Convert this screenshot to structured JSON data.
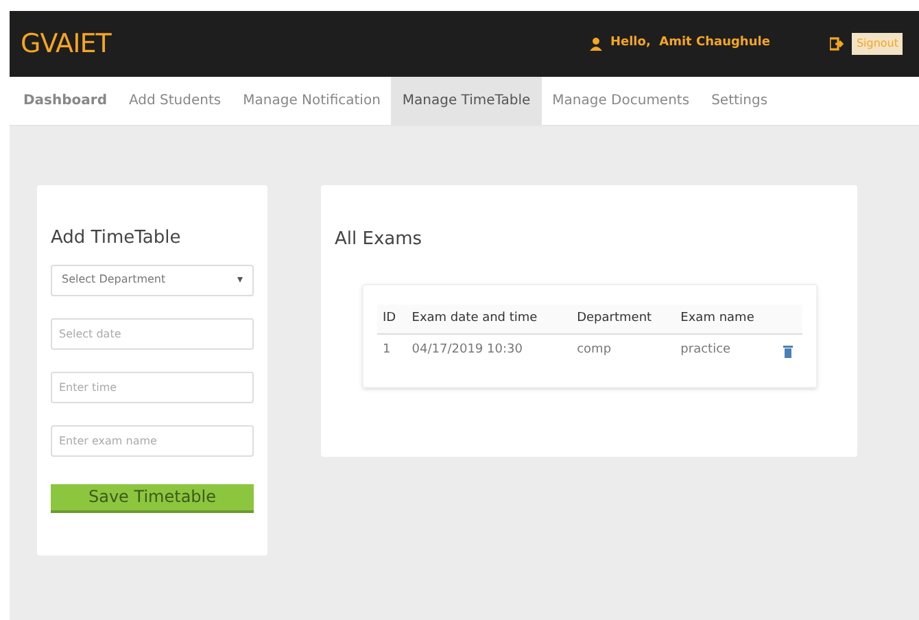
{
  "brand": "GVAIET",
  "user": {
    "greeting": "Hello,  Amit Chaughule",
    "signout": "Signout"
  },
  "nav": [
    {
      "label": "Dashboard",
      "selected": false,
      "bold": true
    },
    {
      "label": "Add Students",
      "selected": false,
      "bold": false
    },
    {
      "label": "Manage Notification",
      "selected": false,
      "bold": false
    },
    {
      "label": "Manage TimeTable",
      "selected": true,
      "bold": false
    },
    {
      "label": "Manage Documents",
      "selected": false,
      "bold": false
    },
    {
      "label": "Settings",
      "selected": false,
      "bold": false
    }
  ],
  "form": {
    "title": "Add TimeTable",
    "fields": [
      {
        "kind": "select",
        "placeholder": "Select Department"
      },
      {
        "kind": "input",
        "placeholder": "Select date"
      },
      {
        "kind": "input",
        "placeholder": "Enter time"
      },
      {
        "kind": "input",
        "placeholder": "Enter exam name"
      }
    ],
    "button": "Save Timetable"
  },
  "exams": {
    "title": "All Exams",
    "columns": [
      "ID",
      "Exam date and time",
      "Department",
      "Exam name"
    ],
    "rows": [
      {
        "cells": [
          "1",
          "04/17/2019 10:30",
          "comp",
          "practice"
        ]
      }
    ]
  }
}
